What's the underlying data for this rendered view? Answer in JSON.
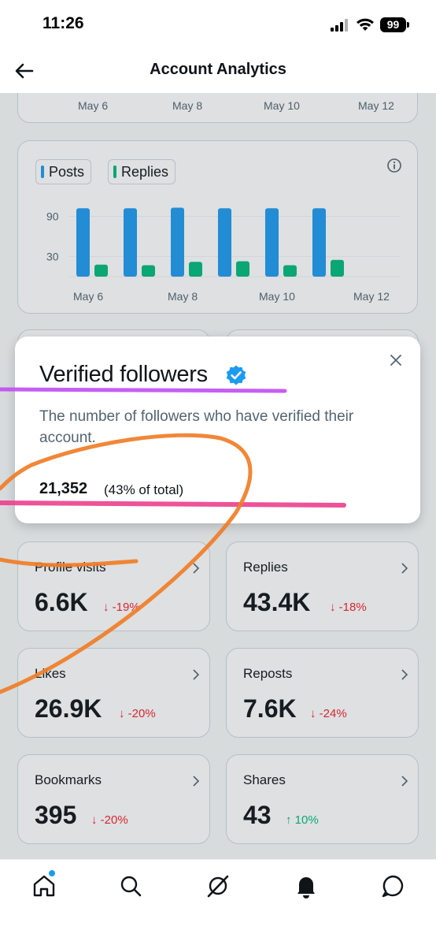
{
  "status_bar": {
    "time": "11:26",
    "battery": "99"
  },
  "header": {
    "title": "Account Analytics"
  },
  "top_chart_axis": {
    "ticks": [
      "May 6",
      "May 8",
      "May 10",
      "May 12"
    ]
  },
  "activity_chart": {
    "legend": {
      "posts": "Posts",
      "replies": "Replies"
    },
    "y_ticks": [
      "90",
      "30"
    ],
    "x_ticks": [
      "May 6",
      "May 8",
      "May 10",
      "May 12"
    ],
    "colors": {
      "posts": "#1d9bf0",
      "replies": "#00ba7c"
    }
  },
  "chart_data": {
    "type": "bar",
    "categories": [
      "May 6",
      "May 7",
      "May 8",
      "May 9",
      "May 10",
      "May 11"
    ],
    "series": [
      {
        "name": "Posts",
        "values": [
          102,
          102,
          103,
          102,
          102,
          102
        ]
      },
      {
        "name": "Replies",
        "values": [
          18,
          17,
          22,
          23,
          17,
          25
        ]
      }
    ],
    "ylim": [
      0,
      120
    ],
    "y_ticks": [
      90,
      30
    ],
    "x_ticks": [
      "May 6",
      "May 8",
      "May 10",
      "May 12"
    ],
    "grid": true,
    "legend": "top-left"
  },
  "popup": {
    "title": "Verified followers",
    "description": "The number of followers who have verified their account.",
    "count": "21,352",
    "percent": "(43% of total)"
  },
  "stats": [
    {
      "label": "Profile visits",
      "value": "6.6K",
      "change": "↓ -19%",
      "direction": "down"
    },
    {
      "label": "Replies",
      "value": "43.4K",
      "change": "↓ -18%",
      "direction": "down"
    },
    {
      "label": "Likes",
      "value": "26.9K",
      "change": "↓ -20%",
      "direction": "down"
    },
    {
      "label": "Reposts",
      "value": "7.6K",
      "change": "↓ -24%",
      "direction": "down"
    },
    {
      "label": "Bookmarks",
      "value": "395",
      "change": "↓ -20%",
      "direction": "down"
    },
    {
      "label": "Shares",
      "value": "43",
      "change": "↑ 10%",
      "direction": "up"
    }
  ],
  "tabs": [
    {
      "icon": "home-icon"
    },
    {
      "icon": "search-icon"
    },
    {
      "icon": "grok-icon"
    },
    {
      "icon": "bell-icon"
    },
    {
      "icon": "messages-icon"
    }
  ],
  "annotation_colors": {
    "purple": "#c04cf2",
    "pink": "#ec3f8c",
    "orange": "#f07d27"
  }
}
